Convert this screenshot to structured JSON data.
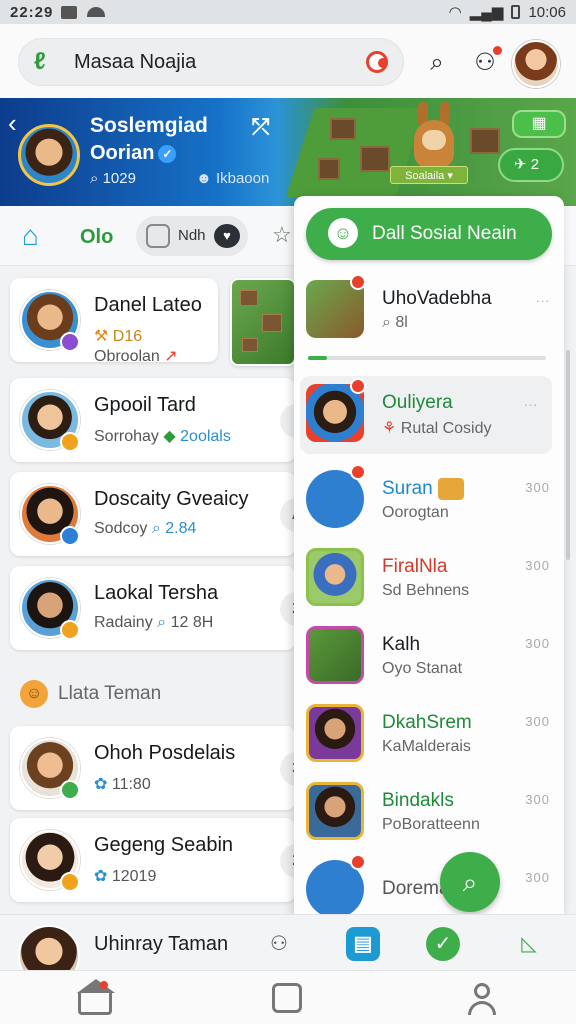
{
  "status_bar": {
    "time": "22:29",
    "right_text": "10:06"
  },
  "search": {
    "query": "Masaa Noajia"
  },
  "banner": {
    "title": "Soslemgiad",
    "subtitle": "Oorian",
    "stat_1": "1029",
    "stat_2": "Ikbaoon",
    "chip": "Soalaila",
    "count": "2"
  },
  "tabs": {
    "t1": "Olo",
    "t2": "Ndh"
  },
  "cards": [
    {
      "name": "Danel Lateo",
      "meta_a": "D16",
      "meta_b": "Obroolan"
    },
    {
      "name": "Gpooil Tard",
      "meta_a": "Sorrohay",
      "meta_b": "2oolals"
    },
    {
      "name": "Doscaity Gveaicy",
      "meta_a": "Sodcoy",
      "meta_b": "2.84",
      "tail": "A"
    },
    {
      "name": "Laokal Tersha",
      "meta_a": "Radainy",
      "meta_b": "12 8H",
      "tail": "2"
    },
    {
      "name": "Ohoh Posdelais",
      "meta_a": "11:80",
      "tail": "3"
    },
    {
      "name": "Gegeng Seabin",
      "meta_a": "12019",
      "tail": "2"
    }
  ],
  "section_label": "Llata Teman",
  "panel": {
    "cta": "Dall Sosial Neain",
    "progress": 0.08,
    "rows": [
      {
        "name": "UhoVadebha",
        "sub": "8l",
        "right": "..."
      },
      {
        "name": "Ouliyera",
        "sub": "Rutal Cosidy",
        "right": "..."
      },
      {
        "name": "Suran",
        "sub": "Oorogtan",
        "right": "300"
      },
      {
        "name": "FiralNla",
        "sub": "Sd Behnens",
        "right": "300"
      },
      {
        "name": "Kalh",
        "sub": "Oyo Stanat",
        "right": "300"
      },
      {
        "name": "DkahSrem",
        "sub": "KaMalderais",
        "right": "300"
      },
      {
        "name": "Bindakls",
        "sub": "PoBoratteenn",
        "right": "300"
      },
      {
        "name": "Dorema",
        "sub": "",
        "right": "300"
      }
    ]
  },
  "minibar": {
    "name": "Uhinray Taman"
  },
  "colors": {
    "accent_green": "#3dae4a",
    "accent_blue": "#1e9ad3",
    "alert_red": "#e8402c"
  }
}
